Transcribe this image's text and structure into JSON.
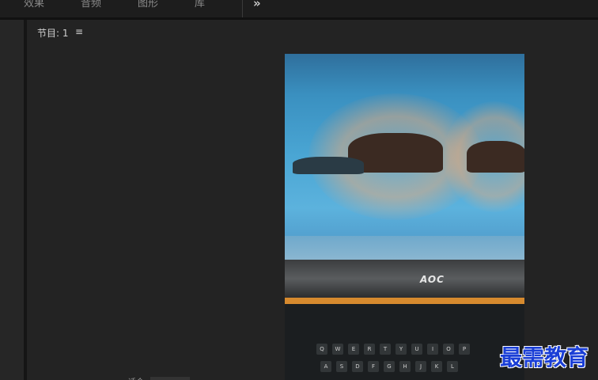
{
  "topbar": {
    "items": [
      "效果",
      "音频",
      "图形",
      "库"
    ],
    "more_label": "»"
  },
  "panel": {
    "title": "节目: 1",
    "menu_icon": "≡"
  },
  "preview": {
    "monitor_brand": "AOC",
    "key_labels": [
      "Q",
      "W",
      "E",
      "R",
      "T",
      "Y",
      "U",
      "I",
      "O",
      "P",
      "A",
      "S",
      "D",
      "F",
      "G",
      "H",
      "J",
      "K",
      "L"
    ]
  },
  "watermark": "最需教育",
  "bottom": {
    "fragment": "适合"
  },
  "colors": {
    "background": "#232323",
    "topbar": "#1d1d1d",
    "watermark": "#1a3ed6"
  }
}
